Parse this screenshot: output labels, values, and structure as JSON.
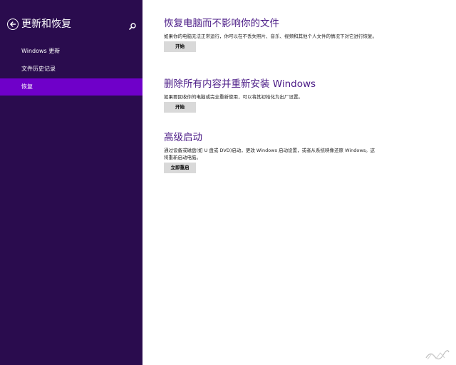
{
  "sidebar": {
    "title": "更新和恢复",
    "items": [
      {
        "label": "Windows 更新",
        "selected": false
      },
      {
        "label": "文件历史记录",
        "selected": false
      },
      {
        "label": "恢复",
        "selected": true
      }
    ]
  },
  "sections": [
    {
      "title": "恢复电脑而不影响你的文件",
      "description": "如果你的电脑无法正常运行，你可以在不丢失照片、音乐、视频和其他个人文件的情况下对它进行恢复。",
      "button": "开始"
    },
    {
      "title": "删除所有内容并重新安装 Windows",
      "description": "如果要回收你的电脑或完全重新使用，可以将其初始化为出厂设置。",
      "button": "开始"
    },
    {
      "title": "高级启动",
      "description": "通过设备或磁盘(如 U 盘或 DVD)启动，更改 Windows 启动设置，或者从系统映像还原 Windows。这将重新启动电脑。",
      "button": "立即重启"
    }
  ],
  "colors": {
    "sidebar_bg": "#2a0c4e",
    "selected_item": "#6f00c9",
    "heading": "#4a1a86",
    "button_bg": "#d9d9d9"
  },
  "icons": {
    "back": "back-arrow-icon",
    "search": "search-icon"
  }
}
